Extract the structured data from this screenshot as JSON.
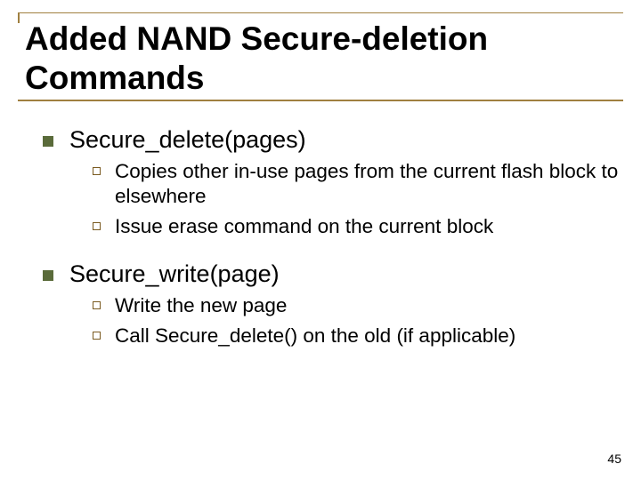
{
  "title": "Added NAND Secure-deletion Commands",
  "sections": [
    {
      "heading": "Secure_delete(pages)",
      "items": [
        "Copies other in-use pages from the current flash block to elsewhere",
        "Issue erase command on the current block"
      ]
    },
    {
      "heading": "Secure_write(page)",
      "items": [
        "Write the new page",
        "Call Secure_delete() on the old (if applicable)"
      ]
    }
  ],
  "page_number": "45"
}
